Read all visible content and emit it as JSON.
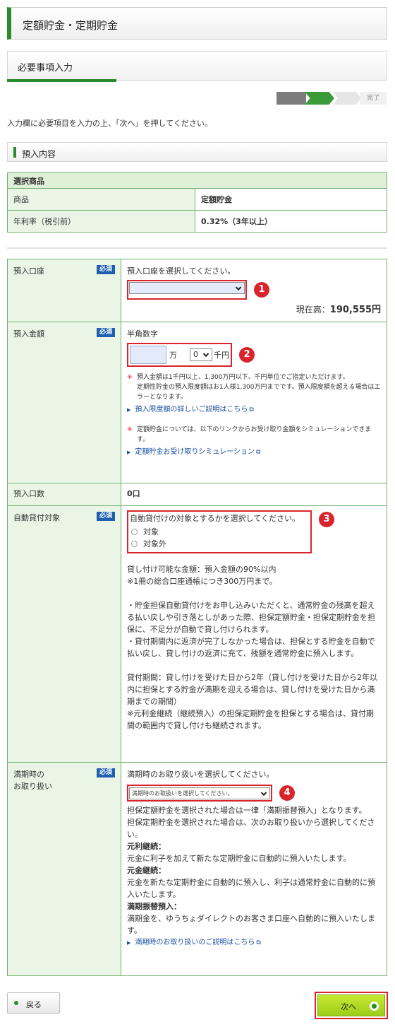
{
  "header": {
    "title": "定額貯金・定期貯金"
  },
  "subheader": {
    "title": "必要事項入力"
  },
  "progress": {
    "done_label": "完了",
    "current_step": 2,
    "total_steps": 4
  },
  "instruction": "入力欄に必要項目を入力の上、「次へ」を押してください。",
  "deposit_section": {
    "title": "預入内容"
  },
  "product_table": {
    "header": "選択商品",
    "rows": [
      {
        "label": "商品",
        "value": "定額貯金"
      },
      {
        "label": "年利率（税引前）",
        "value": "0.32%（3年以上）"
      }
    ]
  },
  "required_badge": "必須",
  "form": {
    "account": {
      "label": "預入口座",
      "prompt": "預入口座を選択してください。",
      "select_value": "",
      "marker": "1",
      "balance_label": "現在高：",
      "balance_value": "190,555円"
    },
    "amount": {
      "label": "預入金額",
      "hint": "半角数字",
      "man_unit": "万",
      "thousand_value": "0",
      "thousand_unit": "千円",
      "marker": "2",
      "notes1": [
        "預入金額は1千円以上、1,300万円以下、千円単位でご指定いただけます。",
        "定期性貯金の預入限度額はお1人様1,300万円までです。預入限度額を超える場合はエラーとなります。"
      ],
      "note_mark": "※",
      "link1": "預入限度額の詳しいご説明はこちら",
      "notes2": "定額貯金については、以下のリンクからお受け取り金額をシミュレーションできます。",
      "link2": "定額貯金お受け取りシミュレーション"
    },
    "count": {
      "label": "預入口数",
      "value": "0口"
    },
    "auto_loan": {
      "label": "自動貸付対象",
      "prompt": "自動貸付けの対象とするかを選択してください。",
      "options": [
        "対象",
        "対象外"
      ],
      "marker": "3",
      "para1_line1": "貸し付け可能な金額：預入金額の90%以内",
      "para1_line2": "※1冊の総合口座通帳につき300万円まで。",
      "para2": "・貯金担保自動貸付けをお申し込みいただくと、通常貯金の残高を超える払い戻しや引き落としがあった際、担保定額貯金・担保定期貯金を担保に、不足分が自動で貸し付けられます。",
      "para3": "・貸付期間内に返済が完了しなかった場合は、担保とする貯金を自動で払い戻し、貸し付けの返済に充て、残額を通常貯金に預入します。",
      "para4": "貸付期間：貸し付けを受けた日から2年（貸し付けを受けた日から2年以内に担保とする貯金が満期を迎える場合は、貸し付けを受けた日から満期までの期間）",
      "para5": "※元利金継続（継続預入）の担保定期貯金を担保とする場合は、貸付期間の範囲内で貸し付けも継続されます。"
    },
    "maturity": {
      "label_line1": "満期時の",
      "label_line2": "お取り扱い",
      "prompt": "満期時のお取り扱いを選択してください。",
      "select_value": "満期時のお取扱いを選択してください。",
      "marker": "4",
      "line1": "担保定額貯金を選択された場合は一律「満期振替預入」となります。",
      "line2": "担保定期貯金を選択された場合は、次のお取り扱いから選択してください。",
      "t1": "元利継続：",
      "d1": "元金に利子を加えて新たな定期貯金に自動的に預入いたします。",
      "t2": "元金継続：",
      "d2": "元金を新たな定期貯金に自動的に預入し、利子は通常貯金に自動的に預入いたします。",
      "t3": "満期振替預入：",
      "d3": "満期金を、ゆうちょダイレクトのお客さま口座へ自動的に預入いたします。",
      "link": "満期時のお取り扱いのご説明はこちら"
    }
  },
  "buttons": {
    "back": "戻る",
    "next": "次へ"
  },
  "colors": {
    "brand_green": "#2a8b2a",
    "highlight_red": "#d9242b",
    "badge_blue": "#1f5fb0",
    "next_lime": "#b5de24"
  }
}
